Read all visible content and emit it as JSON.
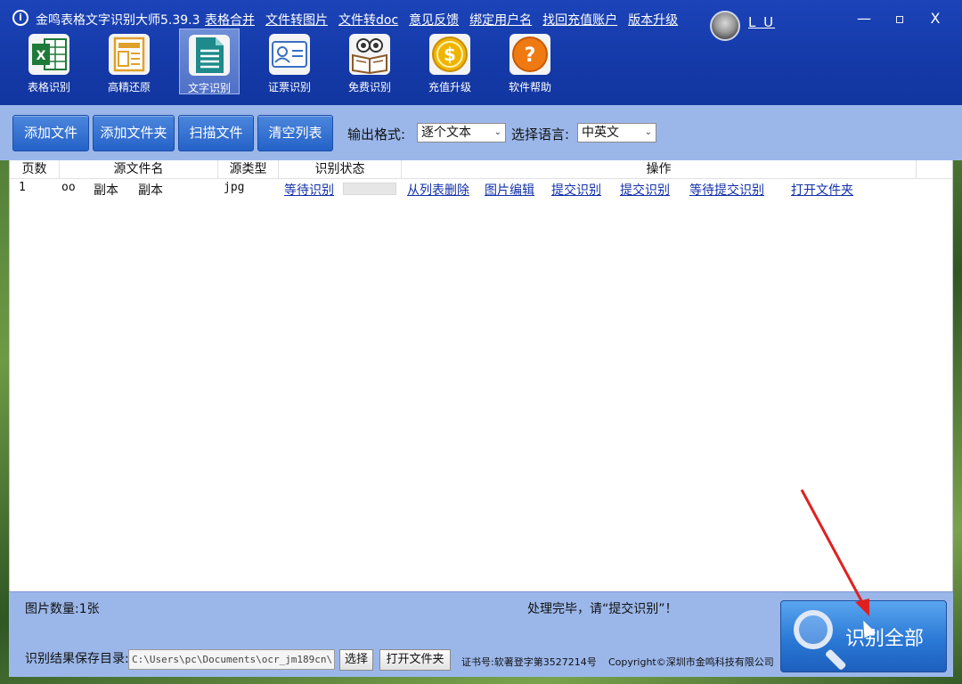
{
  "app": {
    "title": "金鸣表格文字识别大师5.39.3",
    "menu": [
      "表格合并",
      "文件转图片",
      "文件转doc",
      "意见反馈",
      "绑定用户名",
      "找回充值账户",
      "版本升级"
    ],
    "username": "L U",
    "window_controls": {
      "minimize": "—",
      "maximize": "▫",
      "close": "X"
    }
  },
  "tools": [
    {
      "label": "表格识别",
      "icon": "excel-icon",
      "color": "#1f7a3a"
    },
    {
      "label": "高精还原",
      "icon": "layout-icon",
      "color": "#e0a12a"
    },
    {
      "label": "文字识别",
      "icon": "document-icon",
      "color": "#1e8a8c",
      "active": true
    },
    {
      "label": "证票识别",
      "icon": "id-card-icon",
      "color": "#3a6fc4"
    },
    {
      "label": "免费识别",
      "icon": "owl-book-icon",
      "color": "#8a5a2a"
    },
    {
      "label": "充值升级",
      "icon": "coin-icon",
      "color": "#f0b400"
    },
    {
      "label": "软件帮助",
      "icon": "help-icon",
      "color": "#f07a12"
    }
  ],
  "actions": {
    "add_file": "添加文件",
    "add_folder": "添加文件夹",
    "scan_file": "扫描文件",
    "clear_list": "清空列表",
    "output_format_label": "输出格式:",
    "output_format_value": "逐个文本",
    "language_label": "选择语言:",
    "language_value": "中英文"
  },
  "table": {
    "headers": [
      "页数",
      "源文件名",
      "源类型",
      "识别状态",
      "操作"
    ],
    "rows": [
      {
        "pages": "1",
        "name_prefix": "oo",
        "name_a": "副本",
        "name_b": "副本",
        "type": "jpg",
        "status": "等待识别",
        "progress": 0,
        "ops": [
          "从列表删除",
          "图片编辑",
          "提交识别",
          "提交识别",
          "等待提交识别",
          "打开文件夹"
        ]
      }
    ]
  },
  "footer": {
    "image_count": "图片数量:1张",
    "message": "处理完毕，请“提交识别”！",
    "save_dir_label": "识别结果保存目录:",
    "save_dir_value": "C:\\Users\\pc\\Documents\\ocr_jm189cn\\",
    "choose_button": "选择",
    "open_folder_button": "打开文件夹",
    "cert": "证书号:软著登字第3527214号",
    "copyright": "Copyright©深圳市金鸣科技有限公司",
    "recognize_all": "识别全部"
  }
}
